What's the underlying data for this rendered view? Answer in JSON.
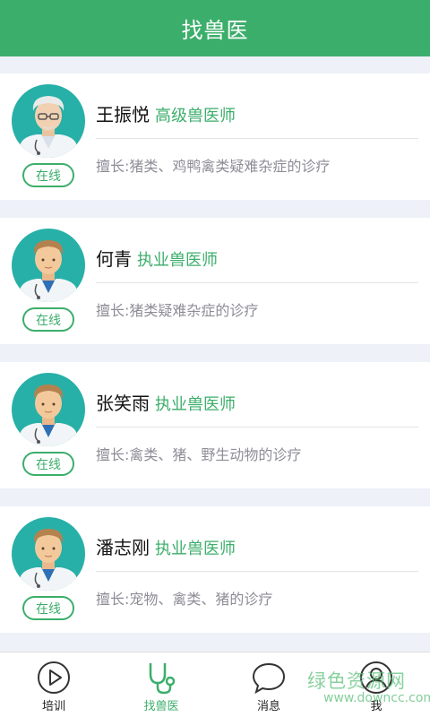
{
  "header": {
    "title": "找兽医"
  },
  "doctors": [
    {
      "name": "王振悦",
      "title": "高级兽医师",
      "status": "在线",
      "specialty": "擅长:猪类、鸡鸭禽类疑难杂症的诊疗",
      "avatar": "senior-doctor-avatar"
    },
    {
      "name": "何青",
      "title": "执业兽医师",
      "status": "在线",
      "specialty": "擅长:猪类疑难杂症的诊疗",
      "avatar": "doctor-avatar"
    },
    {
      "name": "张笑雨",
      "title": "执业兽医师",
      "status": "在线",
      "specialty": "擅长:禽类、猪、野生动物的诊疗",
      "avatar": "doctor-avatar"
    },
    {
      "name": "潘志刚",
      "title": "执业兽医师",
      "status": "在线",
      "specialty": "擅长:宠物、禽类、猪的诊疗",
      "avatar": "doctor-avatar"
    }
  ],
  "tabbar": {
    "items": [
      {
        "label": "培训",
        "icon": "play-circle-icon",
        "active": false
      },
      {
        "label": "找兽医",
        "icon": "stethoscope-icon",
        "active": true
      },
      {
        "label": "消息",
        "icon": "chat-bubble-icon",
        "active": false
      },
      {
        "label": "我",
        "icon": "user-icon",
        "active": false
      }
    ]
  },
  "watermark": {
    "line1": "绿色资源网",
    "line2": "www.downcc.com"
  },
  "colors": {
    "accent": "#3cae6b",
    "avatar_bg": "#27b0a7",
    "background": "#eef1f8"
  }
}
